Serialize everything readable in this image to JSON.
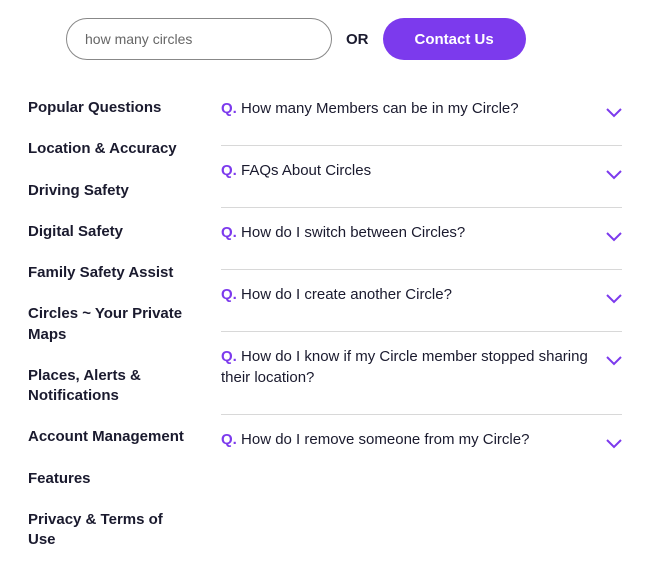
{
  "search": {
    "value": "how many circles"
  },
  "or_label": "OR",
  "contact_label": "Contact Us",
  "sidebar": {
    "items": [
      {
        "label": "Popular Questions"
      },
      {
        "label": "Location & Accuracy"
      },
      {
        "label": "Driving Safety"
      },
      {
        "label": "Digital Safety"
      },
      {
        "label": "Family Safety Assist"
      },
      {
        "label": "Circles ~ Your Private Maps"
      },
      {
        "label": "Places, Alerts & Notifications"
      },
      {
        "label": "Account Management"
      },
      {
        "label": "Features"
      },
      {
        "label": "Privacy & Terms of Use"
      }
    ]
  },
  "faqs": [
    {
      "prefix": "Q.",
      "question": "How many Members can be in my Circle?"
    },
    {
      "prefix": "Q.",
      "question": "FAQs About Circles"
    },
    {
      "prefix": "Q.",
      "question": "How do I switch between Circles?"
    },
    {
      "prefix": "Q.",
      "question": "How do I create another Circle?"
    },
    {
      "prefix": "Q.",
      "question": "How do I know if my Circle member stopped sharing their location?"
    },
    {
      "prefix": "Q.",
      "question": "How do I remove someone from my Circle?"
    }
  ]
}
